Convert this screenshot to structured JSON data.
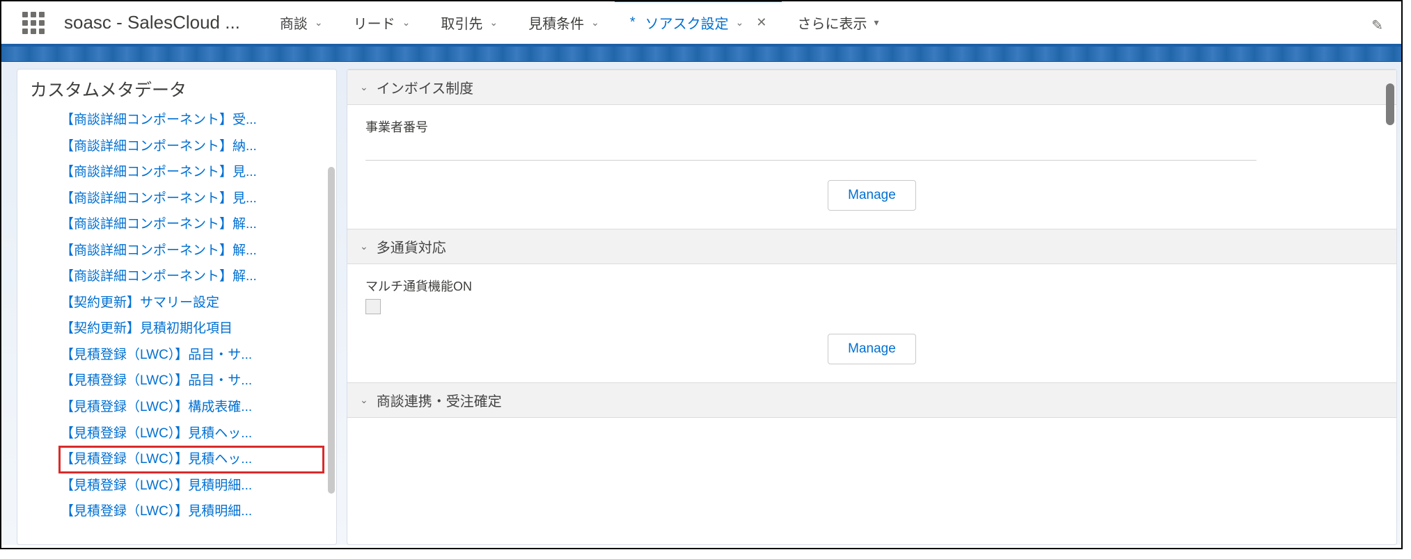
{
  "appName": "soasc - SalesCloud ...",
  "nav": {
    "tabs": [
      {
        "label": "商談"
      },
      {
        "label": "リード"
      },
      {
        "label": "取引先"
      },
      {
        "label": "見積条件"
      }
    ],
    "activeTab": {
      "asterisk": "*",
      "label": "ソアスク設定"
    },
    "more": "さらに表示"
  },
  "sidebar": {
    "title": "カスタムメタデータ",
    "items": [
      "【商談詳細コンポーネント】受...",
      "【商談詳細コンポーネント】納...",
      "【商談詳細コンポーネント】見...",
      "【商談詳細コンポーネント】見...",
      "【商談詳細コンポーネント】解...",
      "【商談詳細コンポーネント】解...",
      "【商談詳細コンポーネント】解...",
      "【契約更新】サマリー設定",
      "【契約更新】見積初期化項目",
      "【見積登録（LWC）】品目・サ...",
      "【見積登録（LWC）】品目・サ...",
      "【見積登録（LWC）】構成表確...",
      "【見積登録（LWC）】見積ヘッ...",
      "【見積登録（LWC）】見積ヘッ...",
      "【見積登録（LWC）】見積明細...",
      "【見積登録（LWC）】見積明細..."
    ],
    "highlightIndex": 13
  },
  "sections": {
    "invoice": {
      "title": "インボイス制度",
      "fieldLabel": "事業者番号",
      "manage": "Manage"
    },
    "multicurrency": {
      "title": "多通貨対応",
      "fieldLabel": "マルチ通貨機能ON",
      "manage": "Manage"
    },
    "opp": {
      "title": "商談連携・受注確定"
    }
  }
}
